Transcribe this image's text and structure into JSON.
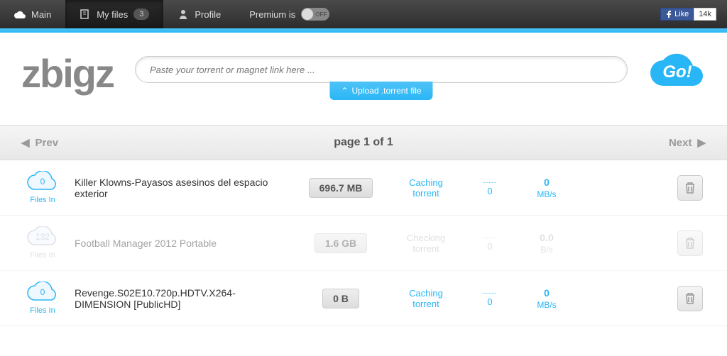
{
  "nav": {
    "main": "Main",
    "myfiles": "My files",
    "myfiles_count": "3",
    "profile": "Profile",
    "premium_label": "Premium is",
    "toggle_state": "OFF"
  },
  "fb": {
    "like": "Like",
    "count": "14k"
  },
  "logo": "zbigz",
  "search": {
    "placeholder": "Paste your torrent or magnet link here ..."
  },
  "upload": "Upload .torrent file",
  "go": "Go!",
  "pager": {
    "prev": "Prev",
    "center": "page 1 of 1",
    "next": "Next"
  },
  "files_label": "Files In",
  "rows": [
    {
      "count": "0",
      "title": "Killer Klowns-Payasos asesinos del espacio exterior",
      "size": "696.7 MB",
      "status": "Caching torrent",
      "seeds": "0",
      "speed": "0",
      "unit": "MB/s",
      "active": true
    },
    {
      "count": "132",
      "title": "Football Manager 2012 Portable",
      "size": "1.6 GB",
      "status": "Checking torrent",
      "seeds": "0",
      "speed": "0.0",
      "unit": "B/s",
      "active": false
    },
    {
      "count": "0",
      "title": "Revenge.S02E10.720p.HDTV.X264-DIMENSION [PublicHD]",
      "size": "0 B",
      "status": "Caching torrent",
      "seeds": "0",
      "speed": "0",
      "unit": "MB/s",
      "active": true
    }
  ]
}
